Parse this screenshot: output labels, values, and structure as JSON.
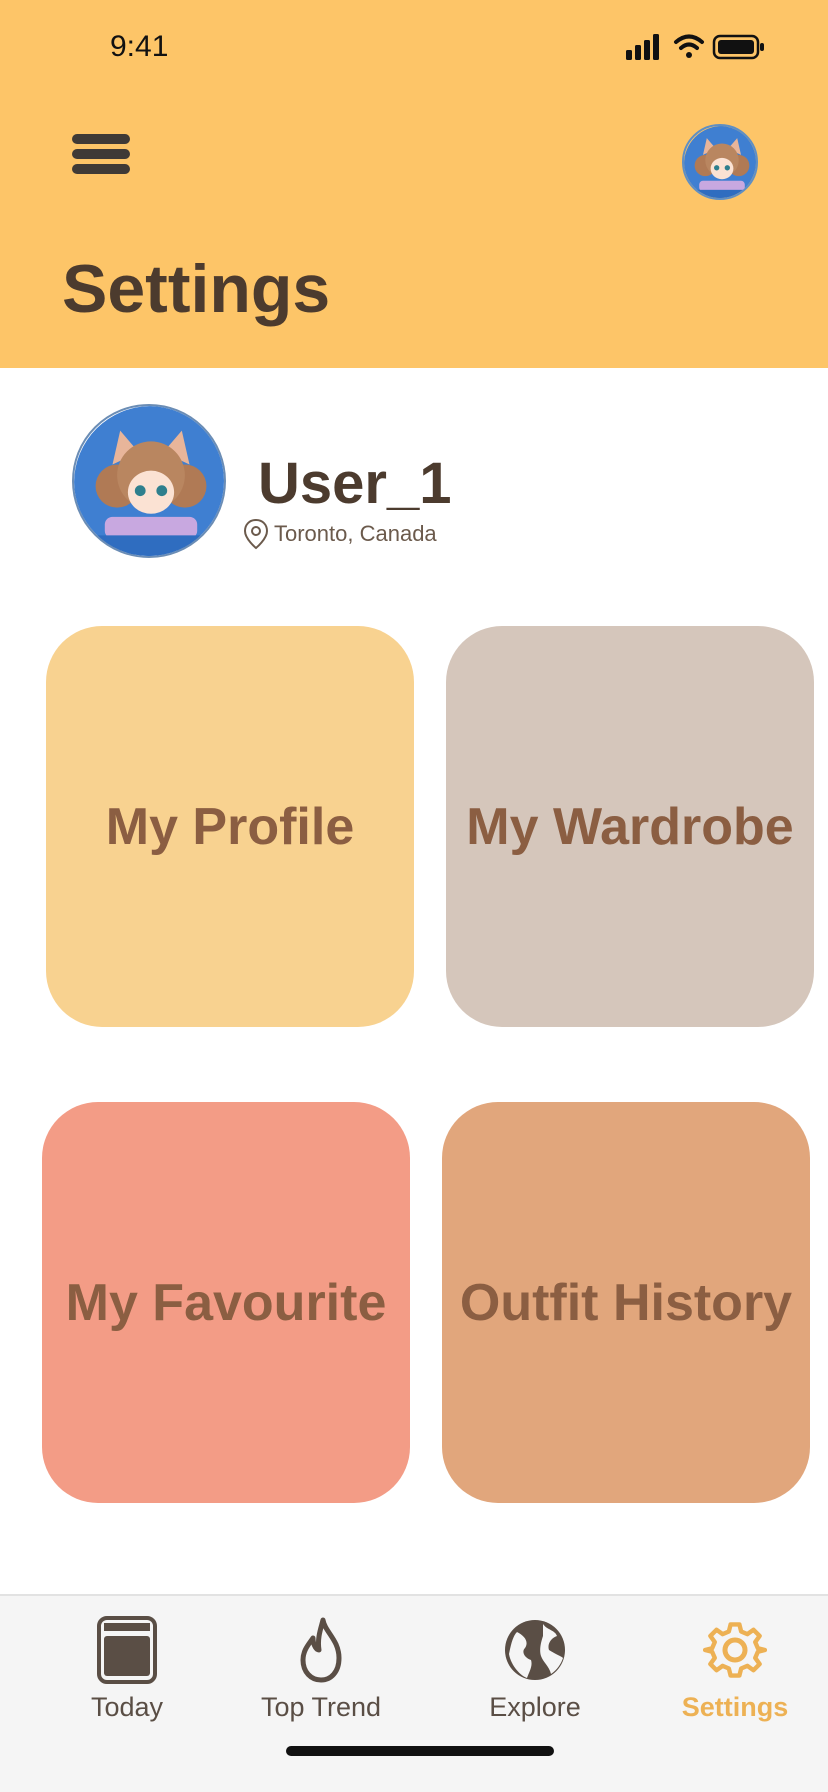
{
  "status_bar": {
    "time": "9:41"
  },
  "header": {
    "title": "Settings"
  },
  "profile": {
    "username": "User_1",
    "location": "Toronto, Canada"
  },
  "tiles": [
    {
      "label": "My Profile",
      "color": "#F8D290"
    },
    {
      "label": "My Wardrobe",
      "color": "#D5C6BB"
    },
    {
      "label": "My Favourite",
      "color": "#F39C86"
    },
    {
      "label": "Outfit History",
      "color": "#E1A67C"
    }
  ],
  "tabbar": {
    "items": [
      {
        "label": "Today",
        "icon": "calendar-icon"
      },
      {
        "label": "Top Trend",
        "icon": "flame-icon"
      },
      {
        "label": "Explore",
        "icon": "globe-icon"
      },
      {
        "label": "Settings",
        "icon": "gear-icon",
        "active": true
      }
    ]
  },
  "colors": {
    "header_bg": "#FDC568",
    "title_text": "#4C3B2E",
    "tile_text": "#8B5E42",
    "active_tab": "#EDB154"
  }
}
